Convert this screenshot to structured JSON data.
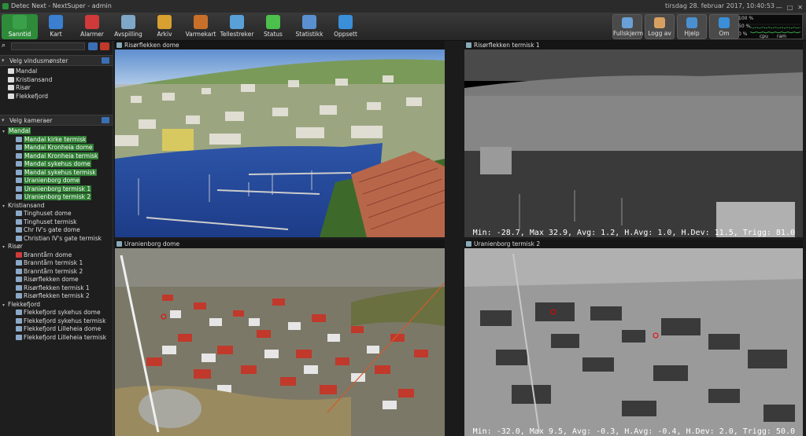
{
  "window": {
    "title": "Detec Next - NextSuper - admin",
    "datetime": "tirsdag 28. februar 2017, 10:40:53"
  },
  "toolbar": {
    "left": [
      {
        "label": "Sanntid",
        "icon": "camera-icon",
        "color": "#3aa14a",
        "active": true
      },
      {
        "label": "Kart",
        "icon": "globe-icon",
        "color": "#3a7fd0"
      },
      {
        "label": "Alarmer",
        "icon": "alarm-icon",
        "color": "#d03a3a"
      },
      {
        "label": "Avspilling",
        "icon": "film-reel-icon",
        "color": "#7fa8c8"
      },
      {
        "label": "Arkiv",
        "icon": "archive-icon",
        "color": "#d8a030"
      },
      {
        "label": "Varmekart",
        "icon": "heatmap-icon",
        "color": "#c8702a"
      },
      {
        "label": "Tellestreker",
        "icon": "count-line-icon",
        "color": "#5aa0d8"
      },
      {
        "label": "Status",
        "icon": "status-cube-icon",
        "color": "#4cc04c"
      },
      {
        "label": "Statistikk",
        "icon": "statistics-icon",
        "color": "#5a8fd0"
      },
      {
        "label": "Oppsett",
        "icon": "gear-icon",
        "color": "#3a8fd8"
      }
    ],
    "right": [
      {
        "label": "Fullskjerm",
        "icon": "fullscreen-icon",
        "color": "#6aa0d8"
      },
      {
        "label": "Logg av",
        "icon": "user-icon",
        "color": "#d8a060"
      },
      {
        "label": "Hjelp",
        "icon": "help-icon",
        "color": "#4a90d0"
      },
      {
        "label": "Om",
        "icon": "info-icon",
        "color": "#3a8fd8"
      }
    ],
    "perf": {
      "pct100": "100 %",
      "pct50": "50 %",
      "pct0": "0 %",
      "cpu": "cpu",
      "ram": "ram",
      "cpu_level": 0.08,
      "ram_level": 0.35
    }
  },
  "sidebar": {
    "window_patterns_title": "Velg vindusmønster",
    "patterns": [
      "Mandal",
      "Kristiansand",
      "Risør",
      "Flekkefjord"
    ],
    "cameras_title": "Velg kameraer",
    "groups": [
      {
        "name": "Mandal",
        "cams": [
          {
            "name": "Mandal kirke termisk",
            "hl": true
          },
          {
            "name": "Mandal Kronheia dome",
            "hl": true
          },
          {
            "name": "Mandal Kronheia termisk",
            "hl": true
          },
          {
            "name": "Mandal sykehus dome",
            "hl": true
          },
          {
            "name": "Mandal sykehus termisk",
            "hl": true
          },
          {
            "name": "Uranienborg dome",
            "hl": true
          },
          {
            "name": "Uranienborg termisk 1",
            "hl": true
          },
          {
            "name": "Uranienborg termisk 2",
            "hl": true
          }
        ]
      },
      {
        "name": "Kristiansand",
        "cams": [
          {
            "name": "Tinghuset dome"
          },
          {
            "name": "Tinghuset termisk"
          },
          {
            "name": "Chr IV's gate dome"
          },
          {
            "name": "Christian IV's gate termisk"
          }
        ]
      },
      {
        "name": "Risør",
        "cams": [
          {
            "name": "Branntårn dome",
            "err": true
          },
          {
            "name": "Branntårn termisk 1"
          },
          {
            "name": "Branntårn termisk 2"
          },
          {
            "name": "Risørflekken dome"
          },
          {
            "name": "Risørflekken termisk 1"
          },
          {
            "name": "Risørflekken termisk 2"
          }
        ]
      },
      {
        "name": "Flekkefjord",
        "cams": [
          {
            "name": "Flekkefjord sykehus dome"
          },
          {
            "name": "Flekkefjord sykehus termisk"
          },
          {
            "name": "Flekkefjord Lilleheia dome"
          },
          {
            "name": "Flekkefjord Lilleheia termisk"
          }
        ]
      }
    ]
  },
  "views": [
    {
      "title": "Risørflekken dome",
      "overlay": ""
    },
    {
      "title": "Risørflekken termisk 1",
      "overlay": "Min: -28.7, Max 32.9, Avg: 1.2, H.Avg: 1.0, H.Dev: 11.5, Trigg: 81.0"
    },
    {
      "title": "Uranienborg dome",
      "overlay": ""
    },
    {
      "title": "Uranienborg termisk 2",
      "overlay": "Min: -32.0, Max 9.5, Avg: -0.3, H.Avg: -0.4, H.Dev: 2.0, Trigg: 50.0"
    }
  ]
}
